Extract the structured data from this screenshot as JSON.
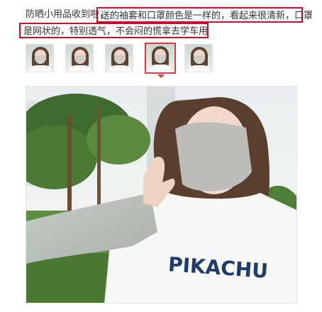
{
  "review": {
    "prefix": "防晒小用品收到啦，",
    "highlight_line1": "送的袖套和口罩颜色是一样的，看起来很清新，口罩",
    "highlight_line2": "是网状的，特别透气，不会闷的慌拿去学车用"
  },
  "thumbnails": [
    {
      "name": "photo-1",
      "selected": false
    },
    {
      "name": "photo-2",
      "selected": false
    },
    {
      "name": "photo-3",
      "selected": false
    },
    {
      "name": "photo-4",
      "selected": true
    },
    {
      "name": "photo-5",
      "selected": false
    }
  ],
  "main_photo": {
    "shirt_print": "PIKACHU"
  },
  "colors": {
    "highlight_border": "#c8102e",
    "selected_thumb_border": "#e4393c",
    "text": "#333333"
  }
}
